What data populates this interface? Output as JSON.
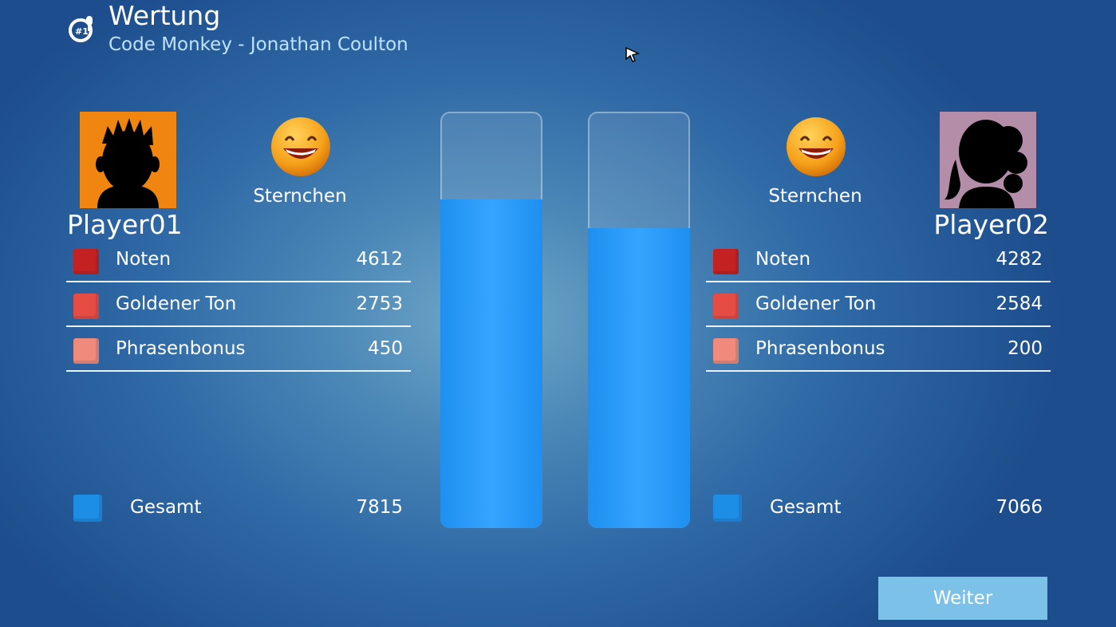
{
  "header": {
    "title": "Wertung",
    "subtitle": "Code Monkey - Jonathan Coulton",
    "logo_icon": "singing-microphone-icon"
  },
  "players": [
    {
      "name": "Player01",
      "rating": "Sternchen",
      "avatar_color": "#f0860f",
      "rows": [
        {
          "label": "Noten",
          "value": "4612",
          "color": "#c42222"
        },
        {
          "label": "Goldener Ton",
          "value": "2753",
          "color": "#e44c44"
        },
        {
          "label": "Phrasenbonus",
          "value": "450",
          "color": "#f08a7c"
        }
      ],
      "total": {
        "label": "Gesamt",
        "value": "7815",
        "color": "#1c8ee6"
      },
      "bar_level": 0.79
    },
    {
      "name": "Player02",
      "rating": "Sternchen",
      "avatar_color": "#b48ea8",
      "rows": [
        {
          "label": "Noten",
          "value": "4282",
          "color": "#c42222"
        },
        {
          "label": "Goldener Ton",
          "value": "2584",
          "color": "#e44c44"
        },
        {
          "label": "Phrasenbonus",
          "value": "200",
          "color": "#f08a7c"
        }
      ],
      "total": {
        "label": "Gesamt",
        "value": "7066",
        "color": "#1c8ee6"
      },
      "bar_level": 0.72
    }
  ],
  "buttons": {
    "continue_label": "Weiter"
  }
}
